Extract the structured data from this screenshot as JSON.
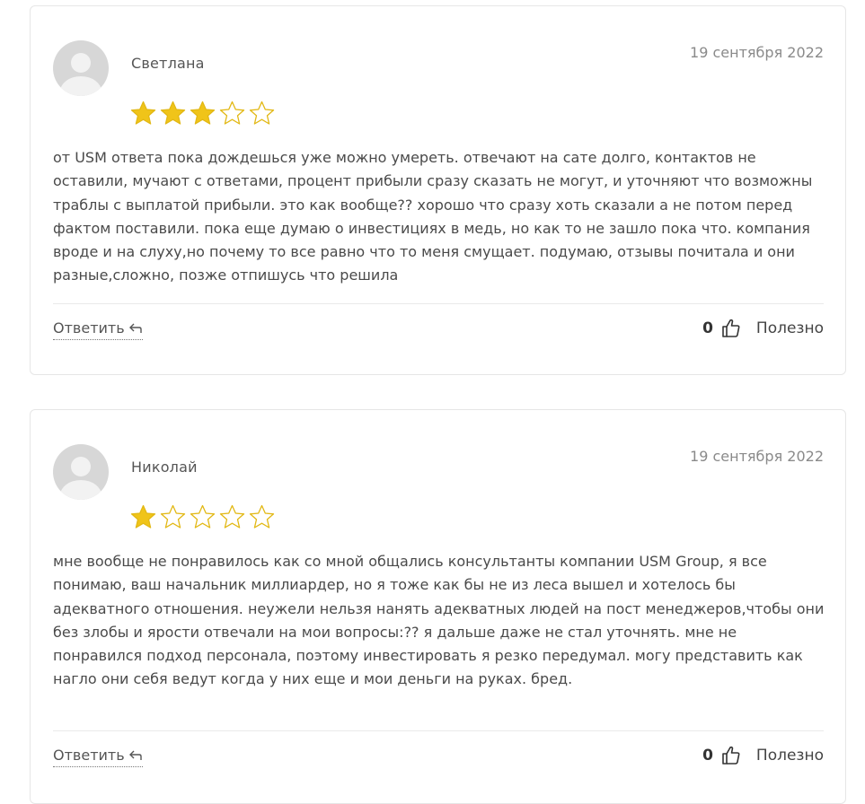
{
  "reviews": [
    {
      "author": "Светлана",
      "date": "19 сентября 2022",
      "rating": 3,
      "max_rating": 5,
      "text": "от USM ответа пока дождешься уже можно умереть. отвечают на сате долго, контактов не оставили, мучают с ответами, процент прибыли сразу сказать не могут, и уточняют что возможны траблы с выплатой прибыли. это как вообще?? хорошо что сразу хоть сказали а не потом перед фактом поставили. пока еще думаю о инвестициях в медь, но как то не зашло пока что. компания вроде и на слуху,но почему то все равно что то меня смущает. подумаю, отзывы почитала и они разные,сложно, позже отпишусь что решила",
      "reply_label": "Ответить",
      "votes": "0",
      "useful_label": "Полезно"
    },
    {
      "author": "Николай",
      "date": "19 сентября 2022",
      "rating": 1,
      "max_rating": 5,
      "text": "мне вообще не понравилось как со мной общались консультанты компании USM Group, я все понимаю, ваш начальник миллиардер, но я тоже как бы не из леса вышел и хотелось бы адекватного отношения. неужели нельзя нанять адекватных людей на пост менеджеров,чтобы они без злобы и ярости отвечали на мои вопросы:?? я дальше даже не стал уточнять. мне не понравился подход персонала, поэтому инвестировать я резко передумал. могу представить как нагло они себя ведут когда у них еще и мои деньги на руках. бред.",
      "reply_label": "Ответить",
      "votes": "0",
      "useful_label": "Полезно"
    }
  ],
  "colors": {
    "star_fill": "#f0c419",
    "star_outline": "#e2b814",
    "text": "#4a4a4a",
    "date": "#8a8a8a",
    "border": "#e6e6e6"
  },
  "icons": {
    "star": "star-icon",
    "reply": "reply-arrow-icon",
    "like": "thumbs-up-icon",
    "avatar": "user-avatar-icon"
  }
}
